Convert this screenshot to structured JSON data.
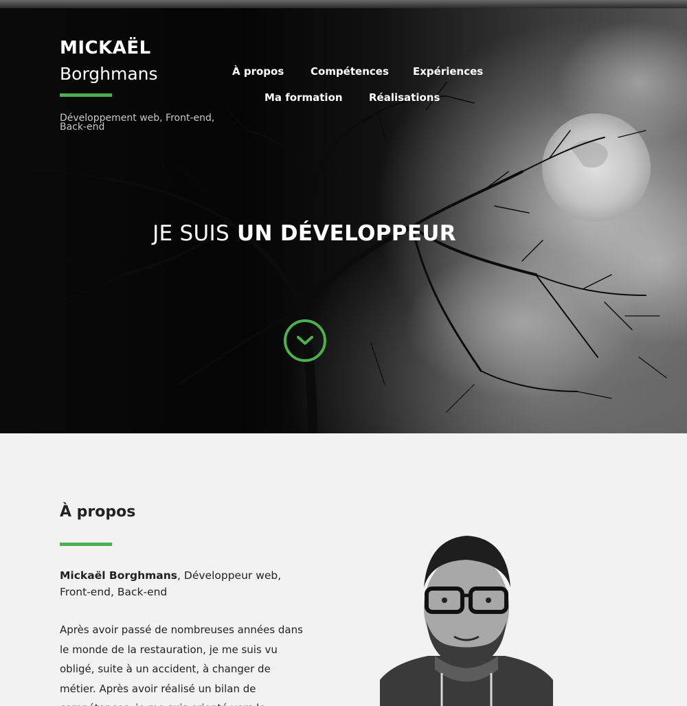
{
  "brand": {
    "first_name": "MICKAËL",
    "last_name": "Borghmans",
    "tagline": "Développement web, Front-end, Back-end"
  },
  "nav": {
    "items": [
      {
        "label": "À propos"
      },
      {
        "label": "Compétences"
      },
      {
        "label": "Expériences"
      },
      {
        "label": "Ma formation"
      },
      {
        "label": "Réalisations"
      }
    ]
  },
  "hero": {
    "headline_light": "JE SUIS",
    "headline_bold": "UN DÉVELOPPEUR",
    "scroll_icon": "chevron-down-circle-icon"
  },
  "about": {
    "title": "À propos",
    "lead_name": "Mickaël Borghmans",
    "lead_rest": ", Développeur web, Front-end, Back-end",
    "body": "Après avoir passé de nombreuses années dans le monde de la restauration, je me suis vu obligé, suite à un accident, à changer de métier. Après avoir réalisé un bilan de compétences, je me suis orienté vers le développement web."
  },
  "colors": {
    "accent": "#4caf50",
    "section_bg": "#f2f2f2",
    "text_dark": "#222222"
  }
}
